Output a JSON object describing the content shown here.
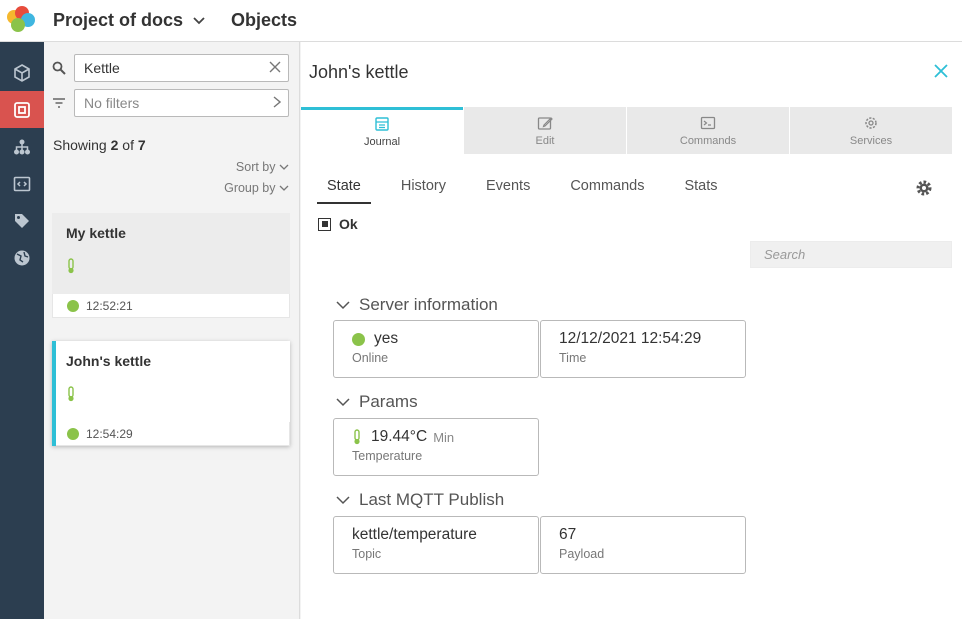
{
  "header": {
    "project": "Project of docs",
    "section": "Objects"
  },
  "colors": {
    "accent": "#2ebfd6",
    "online": "#8bc34a",
    "nav_active": "#d9534f",
    "nav_bg": "#2c3e50"
  },
  "nav": [
    "cube-icon",
    "objects-icon",
    "hierarchy-icon",
    "code-icon",
    "tag-icon",
    "globe-icon"
  ],
  "list": {
    "search_value": "Kettle",
    "filter_placeholder": "No filters",
    "showing_prefix": "Showing ",
    "showing_count": "2",
    "showing_of": " of ",
    "showing_total": "7",
    "sort_by": "Sort by",
    "group_by": "Group by",
    "items": [
      {
        "name": "My kettle",
        "time": "12:52:21"
      },
      {
        "name": "John's kettle",
        "time": "12:54:29"
      }
    ]
  },
  "detail": {
    "title": "John's kettle",
    "tabs": [
      "Journal",
      "Edit",
      "Commands",
      "Services"
    ],
    "subtabs": [
      "State",
      "History",
      "Events",
      "Commands",
      "Stats"
    ],
    "state": "Ok",
    "search_placeholder": "Search",
    "server_info": {
      "title": "Server information",
      "online_value": "yes",
      "online_label": "Online",
      "time_value": "12/12/2021 12:54:29",
      "time_label": "Time"
    },
    "params": {
      "title": "Params",
      "temp_value": "19.44°C",
      "temp_unit": "Min",
      "temp_label": "Temperature"
    },
    "mqtt": {
      "title": "Last MQTT Publish",
      "topic_value": "kettle/temperature",
      "topic_label": "Topic",
      "payload_value": "67",
      "payload_label": "Payload"
    }
  }
}
